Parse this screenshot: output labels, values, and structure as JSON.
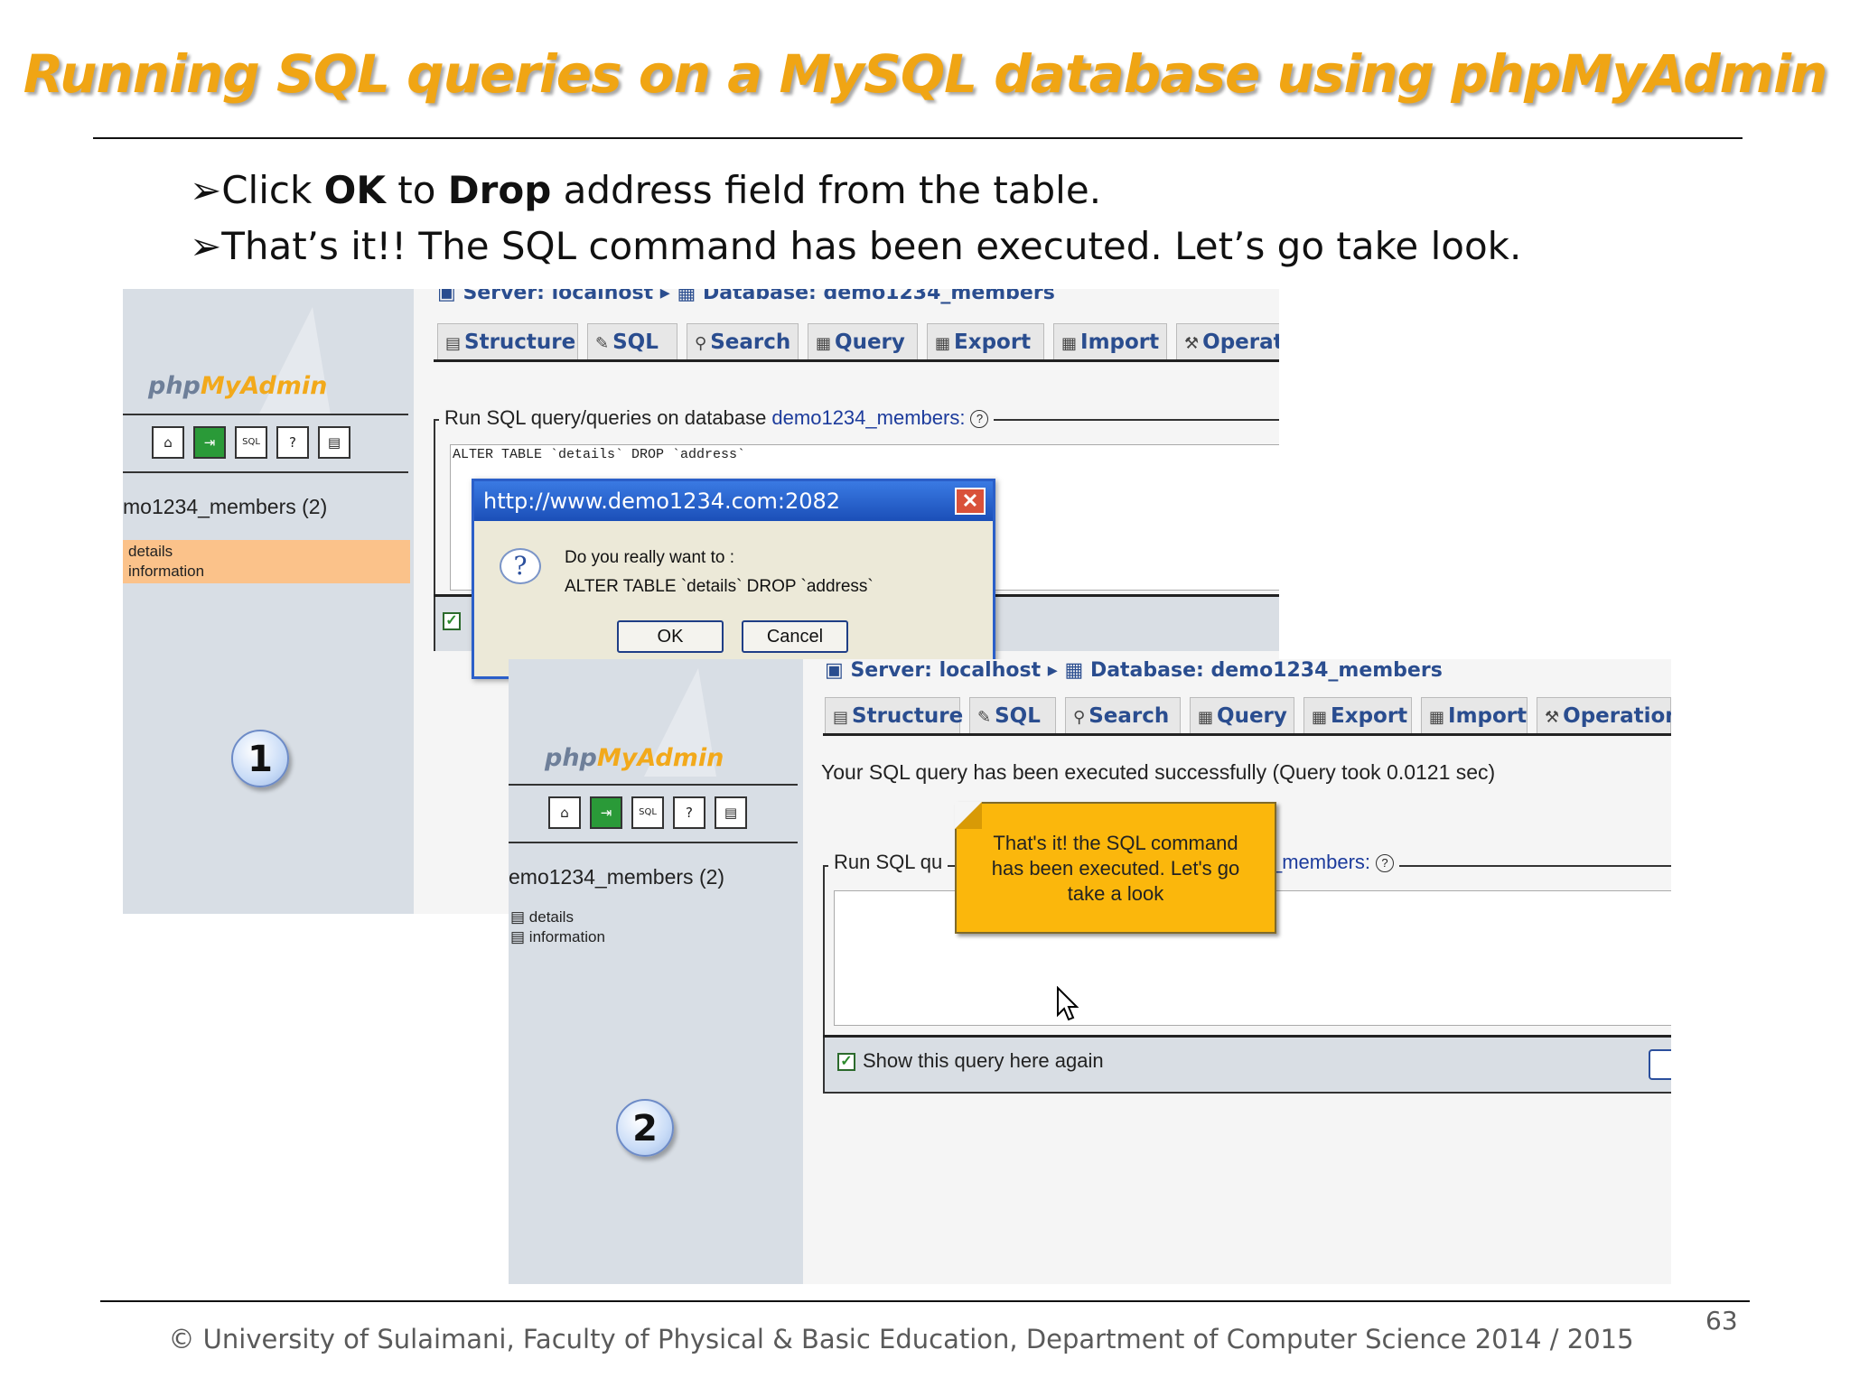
{
  "slide": {
    "title": "Running SQL queries on a MySQL database using phpMyAdmin",
    "bullet1": {
      "pre": "Click ",
      "ok": "OK",
      "mid": " to ",
      "drop": "Drop",
      "post": " address field from the table."
    },
    "bullet2": "That’s it!! The SQL command has been executed. Let’s go take look.",
    "bullet_marker": "➢",
    "footer": "© University of Sulaimani, Faculty of Physical & Basic Education, Department of Computer Science  2014 / 2015",
    "page_number": "63"
  },
  "shot1": {
    "badge": "1",
    "breadcrumb": {
      "server": "Server: localhost",
      "database": "Database: demo1234_members"
    },
    "tabs": [
      "Structure",
      "SQL",
      "Search",
      "Query",
      "Export",
      "Import",
      "Operati"
    ],
    "sidebar": {
      "logo_php": "php",
      "logo_my": "MyAdmin",
      "db": "mo1234_members (2)",
      "tables": [
        "details",
        "information"
      ]
    },
    "sql_legend": "Run SQL query/queries on database ",
    "sql_legend_db": "demo1234_members:",
    "sql_text": "ALTER TABLE `details` DROP `address`",
    "dialog": {
      "title": "http://www.demo1234.com:2082",
      "line1": "Do you really want to :",
      "line2": "ALTER TABLE `details` DROP `address`",
      "ok": "OK",
      "cancel": "Cancel"
    }
  },
  "shot2": {
    "badge": "2",
    "breadcrumb": {
      "server": "Server: localhost",
      "database": "Database: demo1234_members"
    },
    "tabs": [
      "Structure",
      "SQL",
      "Search",
      "Query",
      "Export",
      "Import",
      "Operations"
    ],
    "sidebar": {
      "logo_php": "php",
      "logo_my": "MyAdmin",
      "db": "emo1234_members (2)",
      "tables": [
        "details",
        "information"
      ]
    },
    "success": "Your SQL query has been executed successfully (Query took 0.0121 sec)",
    "sql_legend": "Run SQL qu",
    "sql_legend_db": "_members:",
    "note": "That's it! the SQL command has been executed. Let's go take a look",
    "show_again": "Show this query here again"
  },
  "colors": {
    "title": "#f0a514",
    "link": "#2a4d8f",
    "note": "#fbb70c",
    "dialog_title": "#1b4fb8"
  }
}
